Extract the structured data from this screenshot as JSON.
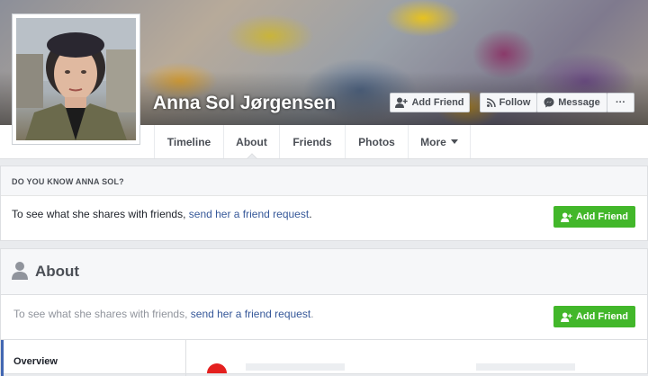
{
  "profile": {
    "name": "Anna Sol Jørgensen"
  },
  "cover_actions": {
    "add_friend": "Add Friend",
    "follow": "Follow",
    "message": "Message",
    "more": "···"
  },
  "tabs": [
    "Timeline",
    "About",
    "Friends",
    "Photos",
    "More"
  ],
  "know_section": {
    "heading": "DO YOU KNOW ANNA SOL?",
    "text": "To see what she shares with friends, ",
    "link": "send her a friend request",
    "end": ".",
    "button": "Add Friend"
  },
  "about": {
    "title": "About",
    "text": "To see what she shares with friends, ",
    "link": "send her a friend request",
    "end": ".",
    "button": "Add Friend",
    "sidebar_item": "Overview"
  },
  "colors": {
    "green": "#42b72a",
    "link": "#365899"
  }
}
